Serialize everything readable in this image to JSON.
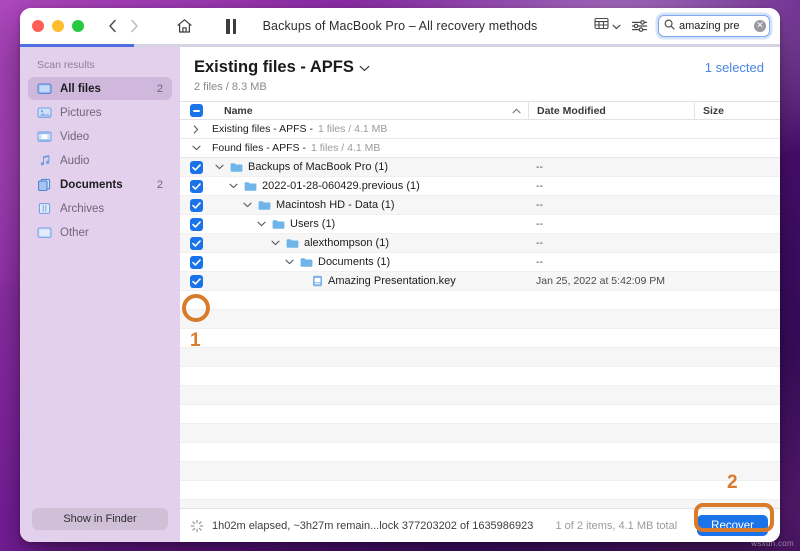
{
  "window": {
    "title": "Backups of MacBook Pro – All recovery methods",
    "traffic_lights": [
      "close",
      "minimize",
      "zoom"
    ],
    "nav": {
      "back": "‹",
      "forward": "›"
    },
    "progress_percent": 15
  },
  "toolbar": {
    "home_icon": "home-icon",
    "pause_icon": "pause-icon",
    "view_icon": "list-view-icon",
    "view_chevron": "chevron-down-icon",
    "filter_icon": "filter-sliders-icon",
    "search": {
      "icon": "search-icon",
      "value": "amazing pre",
      "clear_icon": "clear-circle-icon",
      "clear_glyph": "✕"
    }
  },
  "sidebar": {
    "title": "Scan results",
    "items": [
      {
        "label": "All files",
        "count": "2",
        "icon": "all-files-icon",
        "selected": true,
        "bold": true
      },
      {
        "label": "Pictures",
        "count": "",
        "icon": "pictures-icon",
        "selected": false,
        "bold": false
      },
      {
        "label": "Video",
        "count": "",
        "icon": "video-icon",
        "selected": false,
        "bold": false
      },
      {
        "label": "Audio",
        "count": "",
        "icon": "audio-icon",
        "selected": false,
        "bold": false
      },
      {
        "label": "Documents",
        "count": "2",
        "icon": "documents-icon",
        "selected": false,
        "bold": true
      },
      {
        "label": "Archives",
        "count": "",
        "icon": "archives-icon",
        "selected": false,
        "bold": false
      },
      {
        "label": "Other",
        "count": "",
        "icon": "other-icon",
        "selected": false,
        "bold": false
      }
    ],
    "show_in_finder": "Show in Finder"
  },
  "main": {
    "heading": "Existing files - APFS",
    "heading_chevron": "chevron-down-icon",
    "subtitle": "2 files / 8.3 MB",
    "selected_label": "1 selected",
    "columns": {
      "name": "Name",
      "sort_glyph": "⌃",
      "date_modified": "Date Modified",
      "size": "Size"
    },
    "rows": [
      {
        "kind": "group",
        "indent": 0,
        "expanded": false,
        "checked": null,
        "label": "Existing files - APFS - ",
        "meta": "1 files / 4.1 MB",
        "date": "",
        "size": "",
        "twisty": "›"
      },
      {
        "kind": "group",
        "indent": 0,
        "expanded": true,
        "checked": null,
        "label": "Found files - APFS - ",
        "meta": "1 files / 4.1 MB",
        "date": "",
        "size": "",
        "twisty": "⌄"
      },
      {
        "kind": "folder",
        "indent": 0,
        "expanded": true,
        "checked": true,
        "label": "Backups of MacBook Pro (1)",
        "meta": "",
        "date": "--",
        "size": "",
        "twisty": "⌄"
      },
      {
        "kind": "folder",
        "indent": 1,
        "expanded": true,
        "checked": true,
        "label": "2022-01-28-060429.previous (1)",
        "meta": "",
        "date": "--",
        "size": "",
        "twisty": "⌄"
      },
      {
        "kind": "folder",
        "indent": 2,
        "expanded": true,
        "checked": true,
        "label": "Macintosh HD - Data (1)",
        "meta": "",
        "date": "--",
        "size": "",
        "twisty": "⌄"
      },
      {
        "kind": "folder",
        "indent": 3,
        "expanded": true,
        "checked": true,
        "label": "Users (1)",
        "meta": "",
        "date": "--",
        "size": "",
        "twisty": "⌄"
      },
      {
        "kind": "folder",
        "indent": 4,
        "expanded": true,
        "checked": true,
        "label": "alexthompson (1)",
        "meta": "",
        "date": "--",
        "size": "",
        "twisty": "⌄"
      },
      {
        "kind": "folder",
        "indent": 5,
        "expanded": true,
        "checked": true,
        "label": "Documents (1)",
        "meta": "",
        "date": "--",
        "size": "",
        "twisty": "⌄"
      },
      {
        "kind": "file",
        "indent": 6,
        "expanded": false,
        "checked": true,
        "label": "Amazing Presentation.key",
        "meta": "",
        "date": "Jan 25, 2022 at 5:42:09 PM",
        "size": "",
        "twisty": ""
      }
    ]
  },
  "status": {
    "spinner_icon": "spinner-icon",
    "text": "1h02m elapsed, ~3h27m remain...lock 377203202 of 1635986923",
    "items": "1 of 2 items, 4.1 MB total",
    "recover_label": "Recover"
  },
  "annotations": [
    {
      "number": "1"
    },
    {
      "number": "2"
    }
  ],
  "colors": {
    "accent_blue": "#1a73e8",
    "annotation_orange": "#d97b2a",
    "sidebar_bg": "#e3d0ec",
    "selected_text": "#4b85e0"
  },
  "watermark": "wsxdn.com"
}
